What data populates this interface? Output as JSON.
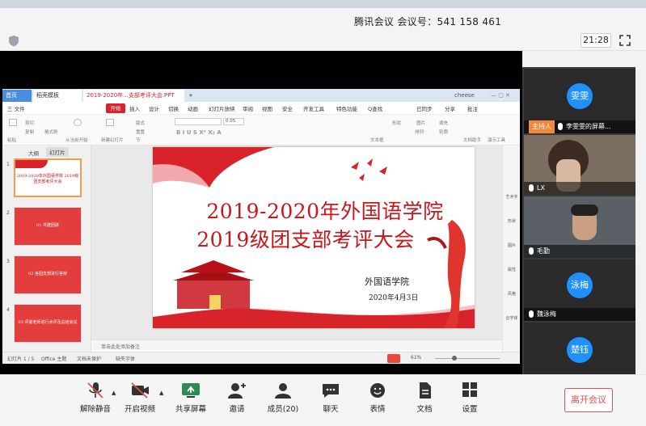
{
  "meeting": {
    "title": "腾讯会议 会议号：541 158 461",
    "time": "21:28"
  },
  "wps": {
    "tabs": [
      "首页",
      "稻壳模板",
      "2019-2020年...支部考评大会.PPT",
      "+"
    ],
    "user": "cheese",
    "menu": [
      "三 文件",
      "开始",
      "插入",
      "设计",
      "切换",
      "动画",
      "幻灯片放映",
      "审阅",
      "视图",
      "安全",
      "开发工具",
      "特色功能",
      "Q查找"
    ],
    "menu_right": [
      "已同步",
      "分享",
      "批注"
    ],
    "ribbon": [
      "粘贴",
      "剪切",
      "复制",
      "格式刷",
      "从当前开始",
      "新建幻灯片",
      "版式",
      "重置",
      "节",
      "文本框",
      "形状",
      "排列",
      "图片",
      "填充",
      "轮廓",
      "文档助手",
      "演示工具"
    ],
    "font_size": "0.05",
    "left_tabs": [
      "大纲",
      "幻灯片"
    ],
    "thumbs": [
      {
        "num": "1",
        "text": "2019-2020年外国语学院 2019级团支部考评大会"
      },
      {
        "num": "2",
        "text": "01 共建团歌"
      },
      {
        "num": "3",
        "text": "02 各团支部进行答辩"
      },
      {
        "num": "4",
        "text": "03 评委老师进行点评及总结会议"
      }
    ],
    "slide": {
      "title_line1": "2019-2020年外国语学院",
      "title_line2": "2019级团支部考评大会",
      "school": "外国语学院",
      "date": "2020年4月3日"
    },
    "notes": "单击此处添加备注",
    "right_side": [
      "艺术字",
      "形状",
      "图片",
      "属性",
      "风格",
      "云字体"
    ],
    "status": {
      "slide_count": "幻灯片 1 / 5",
      "theme": "Office 主题",
      "protect": "文档未保护",
      "font_missing": "缺失字体",
      "zoom": "61%"
    }
  },
  "participants": [
    {
      "avatar": "雯雯",
      "label": "主持人",
      "name": "李雯雯的屏幕...",
      "type": "avatar"
    },
    {
      "name": "LX",
      "type": "video"
    },
    {
      "name": "毛勤",
      "type": "video"
    },
    {
      "avatar": "泳梅",
      "name": "魏泳梅",
      "type": "avatar"
    },
    {
      "avatar": "楚钰",
      "name": "",
      "type": "avatar"
    }
  ],
  "toolbar": {
    "unmute": "解除静音",
    "video": "开启视频",
    "share": "共享屏幕",
    "invite": "邀请",
    "members": "成员(20)",
    "chat": "聊天",
    "emoji": "表情",
    "docs": "文档",
    "settings": "设置",
    "leave": "离开会议"
  },
  "colors": {
    "accent_red": "#c8161d",
    "host_orange": "#f0883e",
    "avatar_blue": "#1e90ff",
    "leave_red": "#e0504a"
  }
}
